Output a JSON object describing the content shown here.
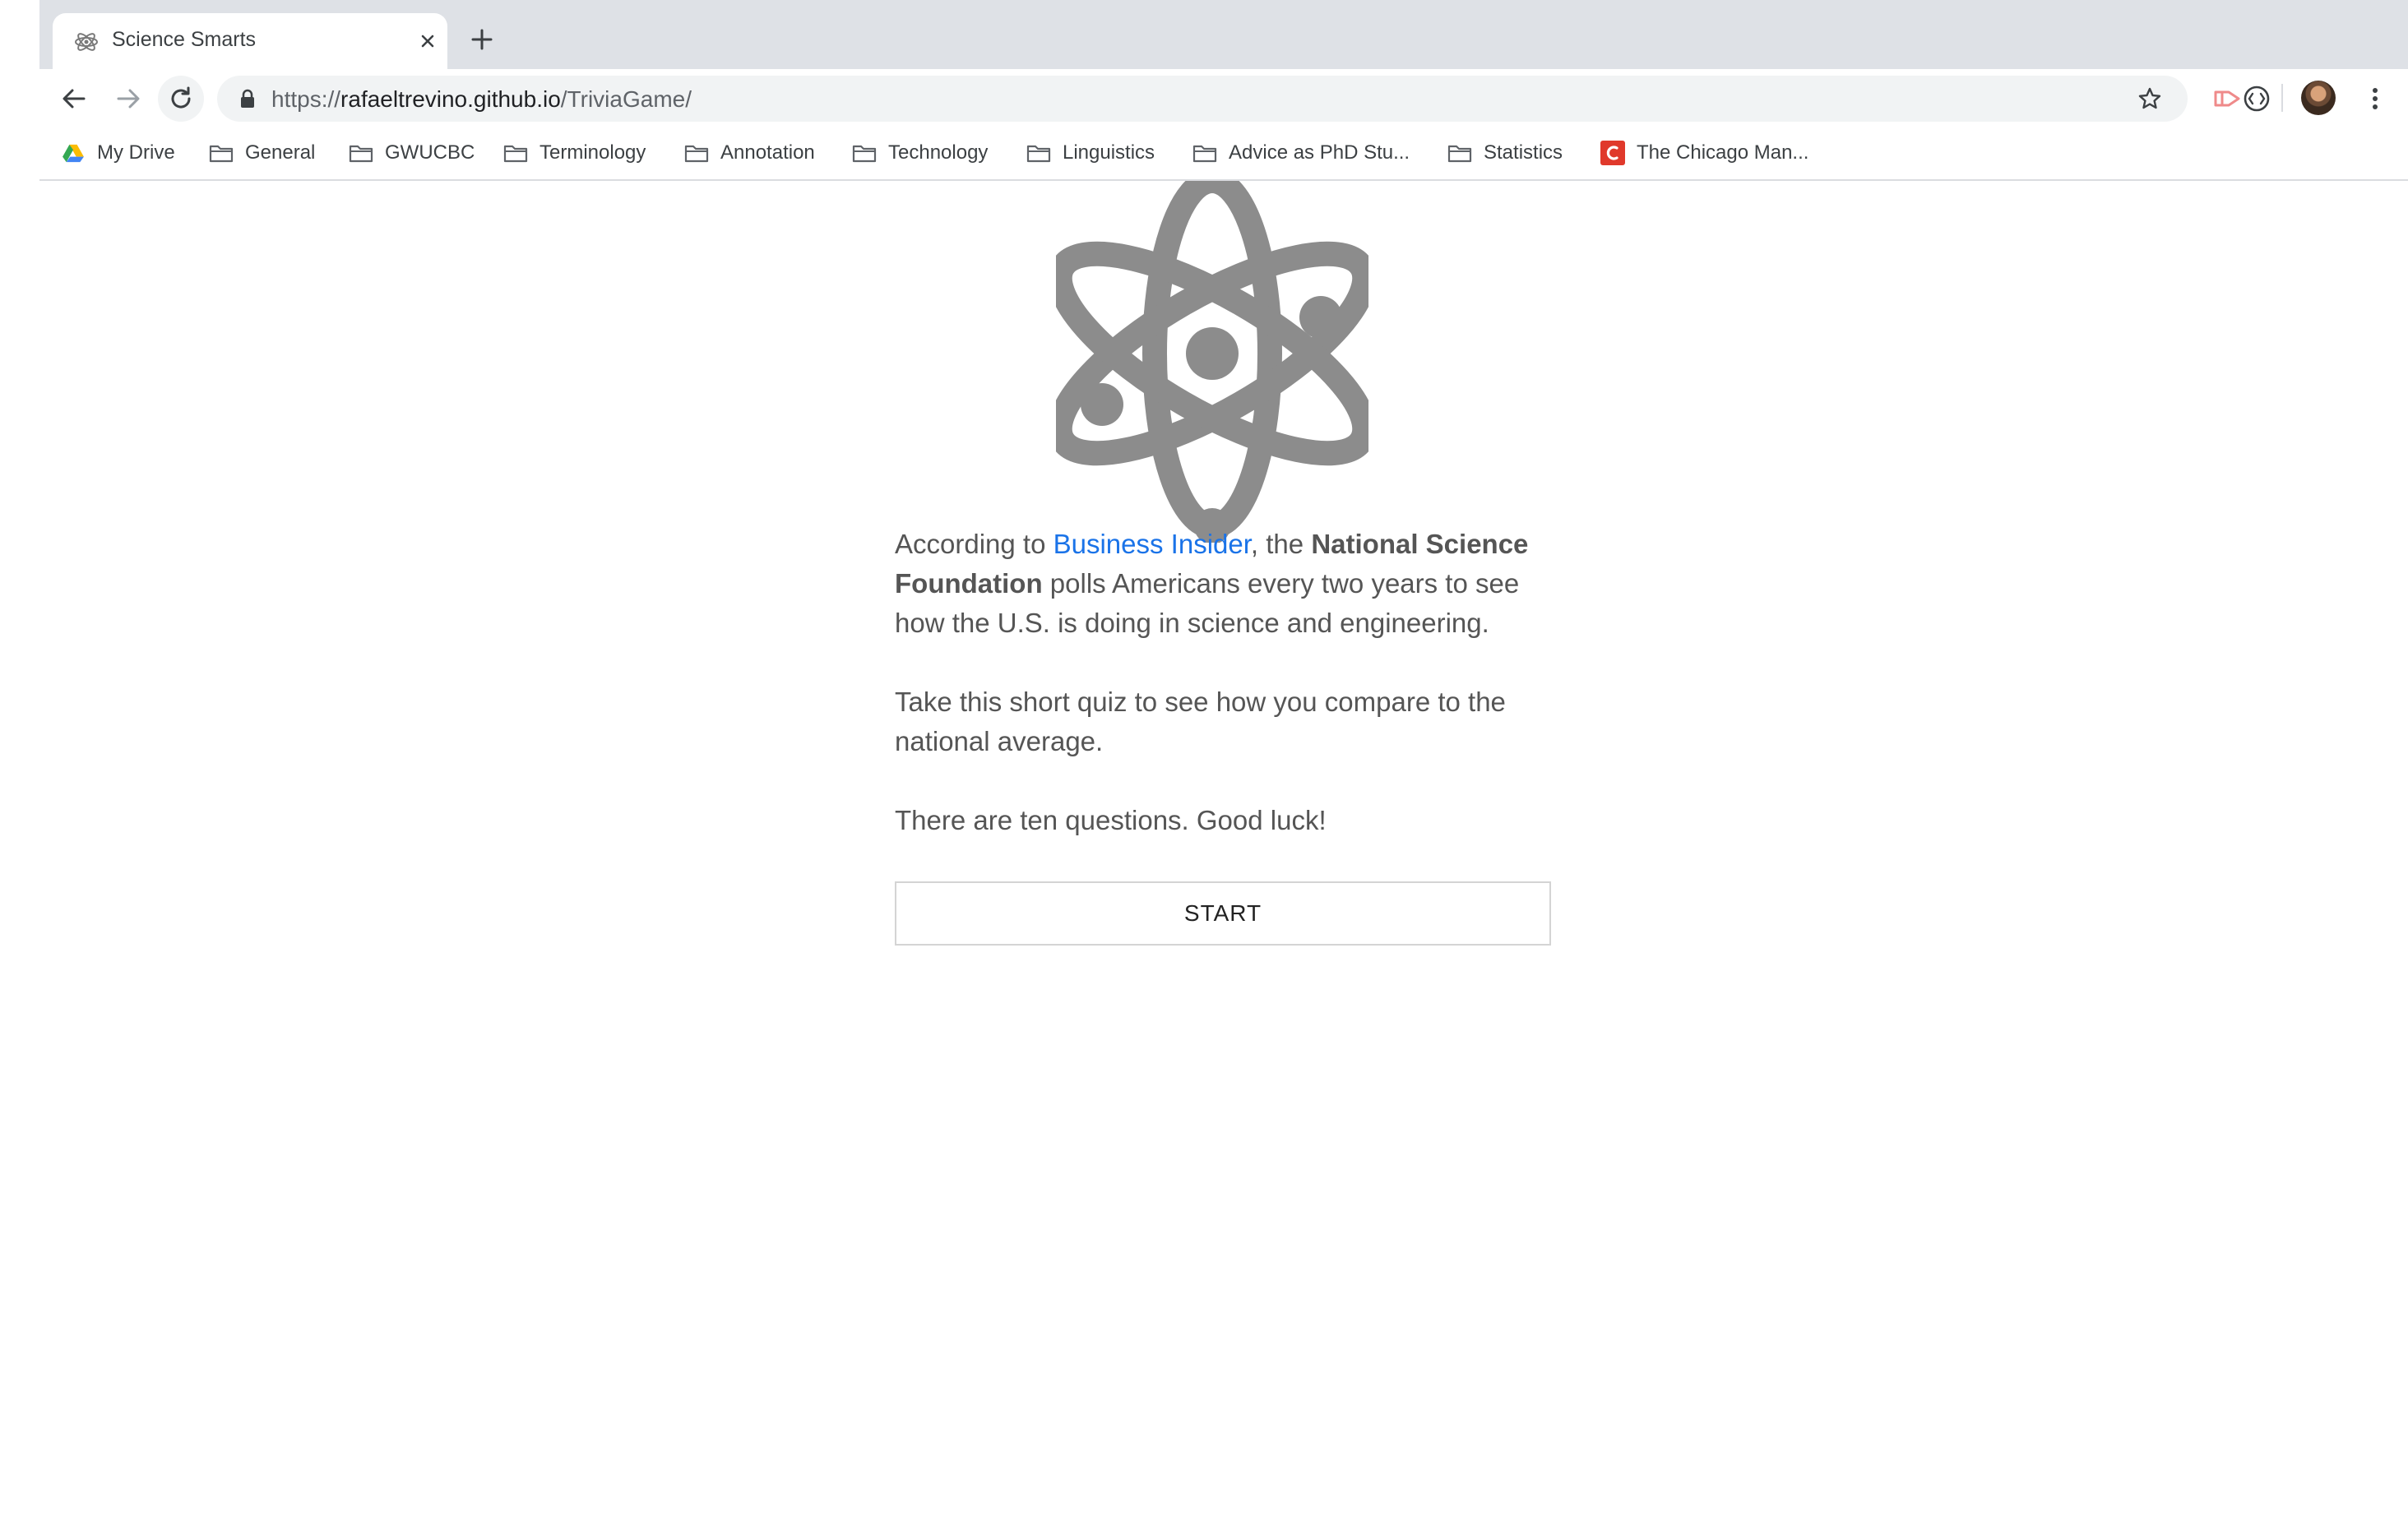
{
  "tab": {
    "title": "Science Smarts"
  },
  "address_bar": {
    "url_scheme": "https://",
    "url_host": "rafaeltrevino.github.io",
    "url_path": "/TriviaGame/"
  },
  "bookmarks": [
    {
      "label": "My Drive",
      "icon": "google-drive-icon"
    },
    {
      "label": "General",
      "icon": "folder-icon"
    },
    {
      "label": "GWUCBC",
      "icon": "folder-icon"
    },
    {
      "label": "Terminology",
      "icon": "folder-icon"
    },
    {
      "label": "Annotation",
      "icon": "folder-icon"
    },
    {
      "label": "Technology",
      "icon": "folder-icon"
    },
    {
      "label": "Linguistics",
      "icon": "folder-icon"
    },
    {
      "label": "Advice as PhD Stu...",
      "icon": "folder-icon"
    },
    {
      "label": "Statistics",
      "icon": "folder-icon"
    },
    {
      "label": "The Chicago Man...",
      "icon": "chicago-manual-icon"
    }
  ],
  "intro": {
    "p1_before_link": "According to ",
    "p1_link": "Business Insider",
    "p1_after_link": ", the ",
    "p1_bold": "National Science Foundation",
    "p1_rest": " polls Americans every two years to see how the U.S. is doing in science and engineering.",
    "p2": "Take this short quiz to see how you compare to the national average.",
    "p3": "There are ten questions. Good luck!"
  },
  "start_button": {
    "label": "START"
  },
  "colors": {
    "accent_link": "#1a73e8",
    "atom_gray": "#8c8c8c",
    "text_gray": "#555555"
  }
}
